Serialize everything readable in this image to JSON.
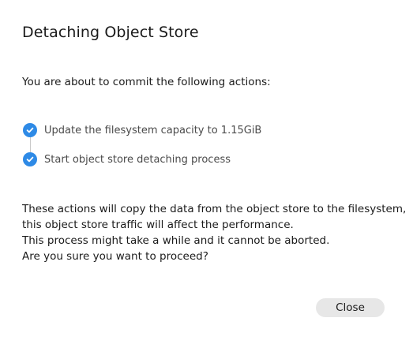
{
  "dialog": {
    "title": "Detaching Object Store",
    "intro": "You are about to commit the following actions:",
    "steps": [
      {
        "label": "Update the filesystem capacity to 1.15GiB",
        "icon": "check-circle-icon",
        "status": "done"
      },
      {
        "label": "Start object store detaching process",
        "icon": "check-circle-icon",
        "status": "done"
      }
    ],
    "body_lines": [
      "These actions will copy the data from the object store to the filesystem,",
      "this object store traffic will affect the performance.",
      "This process might take a while and it cannot be aborted.",
      "Are you sure you want to proceed?"
    ],
    "close_label": "Close"
  },
  "colors": {
    "accent": "#2e8ae6",
    "button_bg": "#e7e7e7",
    "connector": "#c9c9c9"
  }
}
